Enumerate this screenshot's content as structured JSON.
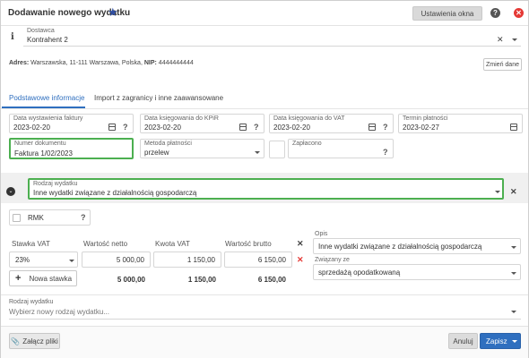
{
  "window": {
    "title": "Dodawanie nowego wydatku",
    "settings_btn": "Ustawienia okna",
    "help": "?"
  },
  "supplier": {
    "label": "Dostawca",
    "value": "Kontrahent 2",
    "address_label": "Adres:",
    "address": "Warszawska, 11-111 Warszawa, Polska,",
    "nip_label": "NIP:",
    "nip": "4444444444",
    "change_btn": "Zmień dane"
  },
  "tabs": [
    {
      "label": "Podstawowe informacje"
    },
    {
      "label": "Import z zagranicy i inne zaawansowane"
    }
  ],
  "dates": [
    {
      "label": "Data wystawienia faktury",
      "value": "2023-02-20"
    },
    {
      "label": "Data księgowania do KPiR",
      "value": "2023-02-20"
    },
    {
      "label": "Data księgowania do VAT",
      "value": "2023-02-20"
    },
    {
      "label": "Termin płatności",
      "value": "2023-02-27"
    }
  ],
  "document": {
    "label": "Numer dokumentu",
    "value": "Faktura 1/02/2023"
  },
  "payment": {
    "label": "Metoda płatności",
    "value": "przelew"
  },
  "paid": {
    "label": "Zapłacono"
  },
  "expense_type": {
    "label": "Rodzaj wydatku",
    "value": "Inne wydatki związane z działalnością gospodarczą"
  },
  "rmk": {
    "label": "RMK"
  },
  "vat_table": {
    "headers": [
      "Stawka VAT",
      "Wartość netto",
      "Kwota VAT",
      "Wartość brutto"
    ],
    "row": {
      "rate": "23%",
      "net": "5 000,00",
      "vat": "1 150,00",
      "gross": "6 150,00"
    },
    "totals": {
      "net": "5 000,00",
      "vat": "1 150,00",
      "gross": "6 150,00"
    },
    "add_btn": "Nowa stawka"
  },
  "description": {
    "label": "Opis",
    "value": "Inne wydatki związane z działalnością gospodarczą"
  },
  "related": {
    "label": "Związany ze",
    "value": "sprzedażą opodatkowaną"
  },
  "new_expense": {
    "label": "Rodzaj wydatku",
    "placeholder": "Wybierz nowy rodzaj wydatku..."
  },
  "footer": {
    "attach_btn": "Załącz pliki",
    "cancel_btn": "Anuluj",
    "save_btn": "Zapisz"
  },
  "colors": {
    "accent": "#2f6fbf",
    "green": "#4caf50",
    "close": "#e53935",
    "star": "#2f4ea1"
  }
}
